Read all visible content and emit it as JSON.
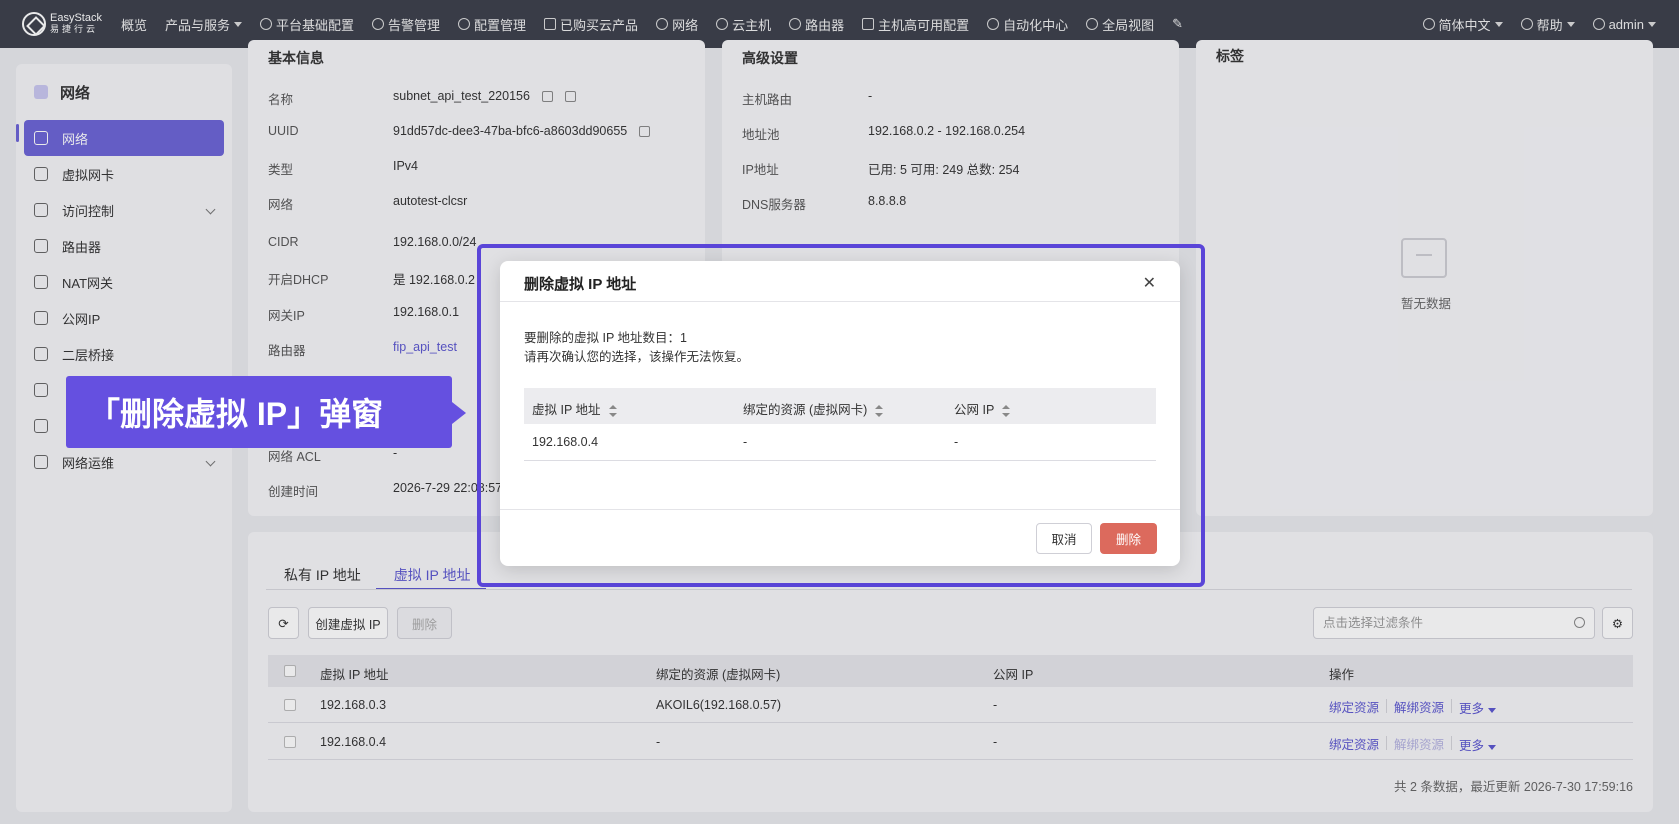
{
  "nav": {
    "logo_text": "EasyStack",
    "logo_sub": "易捷行云",
    "items": [
      "概览",
      "产品与服务",
      "平台基础配置",
      "告警管理",
      "配置管理",
      "已购买云产品",
      "网络",
      "云主机",
      "路由器",
      "主机高可用配置",
      "自动化中心",
      "全局视图"
    ],
    "lang": "简体中文",
    "help": "帮助",
    "user": "admin"
  },
  "sidebar": {
    "title": "网络",
    "items": [
      "网络",
      "虚拟网卡",
      "访问控制",
      "路由器",
      "NAT网关",
      "公网IP",
      "二层桥接",
      "",
      "",
      "网络运维"
    ]
  },
  "basic": {
    "title": "基本信息",
    "labels": [
      "名称",
      "UUID",
      "类型",
      "网络",
      "CIDR",
      "开启DHCP",
      "网关IP",
      "路由器",
      "网络 ACL",
      "创建时间"
    ],
    "values": [
      "subnet_api_test_220156",
      "91dd57dc-dee3-47ba-bfc6-a8603dd90655",
      "IPv4",
      "autotest-clcsr",
      "192.168.0.0/24",
      "是  192.168.0.2",
      "192.168.0.1",
      "fip_api_test",
      "-",
      "2026-7-29 22:08:57"
    ]
  },
  "advanced": {
    "title": "高级设置",
    "labels": [
      "主机路由",
      "地址池",
      "IP地址",
      "DNS服务器"
    ],
    "values": [
      "-",
      "192.168.0.2 - 192.168.0.254",
      "已用: 5   可用: 249   总数: 254",
      "8.8.8.8"
    ]
  },
  "tags": {
    "title": "标签",
    "empty": "暂无数据"
  },
  "tabs": [
    "私有 IP 地址",
    "虚拟 IP 地址"
  ],
  "toolbar": {
    "create": "创建虚拟 IP",
    "delete": "删除",
    "filter_placeholder": "点击选择过滤条件"
  },
  "table": {
    "headers": [
      "虚拟 IP 地址",
      "绑定的资源 (虚拟网卡)",
      "公网 IP",
      "操作"
    ],
    "rows": [
      {
        "ip": "192.168.0.3",
        "resource": "AKOIL6(192.168.0.57)",
        "public_ip": "-"
      },
      {
        "ip": "192.168.0.4",
        "resource": "-",
        "public_ip": "-"
      }
    ],
    "ops": {
      "bind": "绑定资源",
      "unbind": "解绑资源",
      "more": "更多"
    },
    "footer": "共 2 条数据，最近更新  2026-7-30 17:59:16"
  },
  "modal": {
    "title": "删除虚拟 IP 地址",
    "line1": "要删除的虚拟 IP 地址数目：1",
    "line2": "请再次确认您的选择，该操作无法恢复。",
    "headers": [
      "虚拟 IP 地址",
      "绑定的资源 (虚拟网卡)",
      "公网 IP"
    ],
    "row": [
      "192.168.0.4",
      "-",
      "-"
    ],
    "cancel": "取消",
    "confirm": "删除"
  },
  "callout": "「删除虚拟 IP」弹窗",
  "colors": {
    "accent": "#6b64d6",
    "danger": "#dc6a5d",
    "callout": "#6550e0",
    "topbar": "#3b3f4a"
  }
}
